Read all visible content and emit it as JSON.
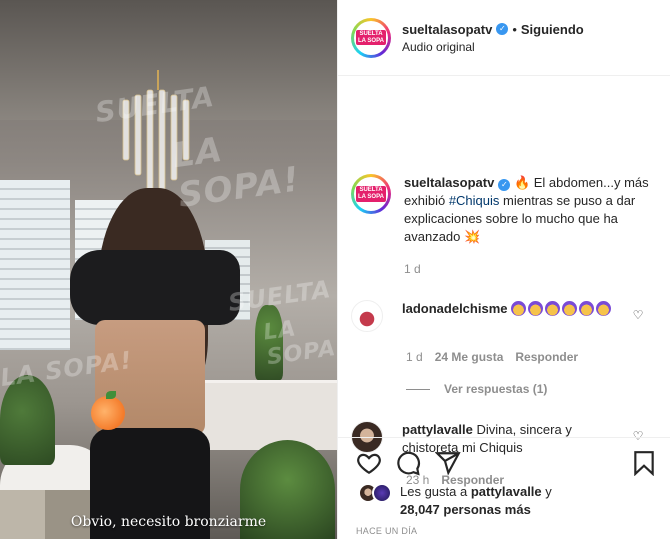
{
  "media": {
    "watermark_line1": "SUELTA",
    "watermark_line2": "LA SOPA!",
    "caption": "Obvio, necesito bronziarme"
  },
  "header": {
    "username": "sueltalasopatv",
    "separator": "•",
    "follow_label": "Siguiendo",
    "audio_label": "Audio original"
  },
  "post": {
    "username": "sueltalasopatv",
    "text_before": " 🔥 El abdomen...y más exhibió ",
    "hashtag": "#Chiquis",
    "text_after": " mientras se puso a dar explicaciones sobre lo mucho que ha avanzado 💥",
    "time": "1 d"
  },
  "comments": [
    {
      "username": "ladonadelchisme",
      "text": "🙆‍♀️🙆‍♀️🙆‍♀️🙆‍♀️🙆‍♀️🙆‍♀️",
      "time": "1 d",
      "likes": "24 Me gusta",
      "reply_label": "Responder",
      "view_replies": "Ver respuestas (1)"
    },
    {
      "username": "pattylavalle",
      "text": "Divina, sincera y chistoreta mi Chiquis",
      "time": "23 h",
      "reply_label": "Responder"
    }
  ],
  "actions": {
    "likes_prefix": "Les gusta a ",
    "likes_user": "pattylavalle",
    "likes_and": " y",
    "likes_count": "28,047 personas más",
    "time_ago": "HACE UN DÍA"
  },
  "icons": [
    "heart-icon",
    "comment-icon",
    "share-icon",
    "bookmark-icon"
  ],
  "colors": {
    "hashtag": "#00376b",
    "verified": "#3897f0",
    "muted": "#8e8e8e"
  }
}
